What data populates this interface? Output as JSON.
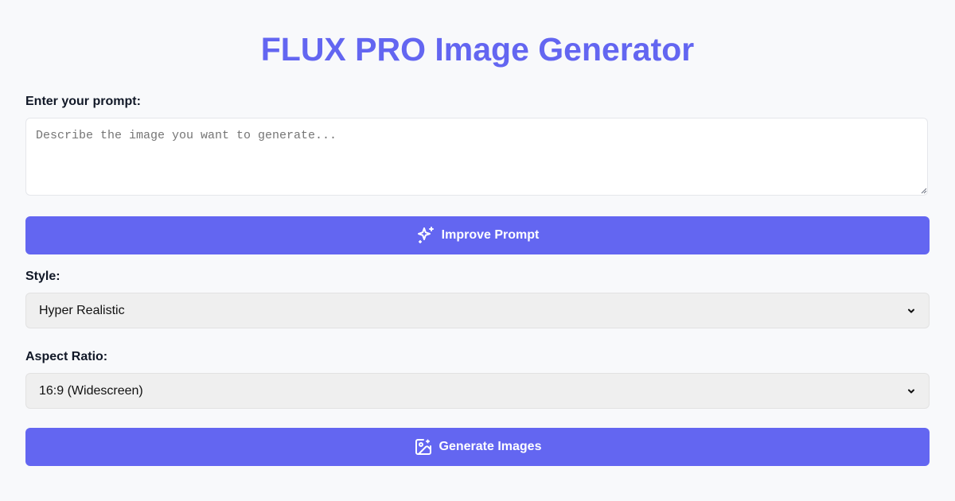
{
  "header": {
    "title": "FLUX PRO Image Generator"
  },
  "prompt": {
    "label": "Enter your prompt:",
    "placeholder": "Describe the image you want to generate...",
    "value": ""
  },
  "improve_button": {
    "label": "Improve Prompt",
    "icon": "sparkles-icon"
  },
  "style": {
    "label": "Style:",
    "selected": "Hyper Realistic"
  },
  "aspect_ratio": {
    "label": "Aspect Ratio:",
    "selected": "16:9 (Widescreen)"
  },
  "generate_button": {
    "label": "Generate Images",
    "icon": "image-plus-icon"
  },
  "colors": {
    "accent": "#6366f1",
    "background": "#f8f9fb",
    "select_background": "#efefef"
  }
}
